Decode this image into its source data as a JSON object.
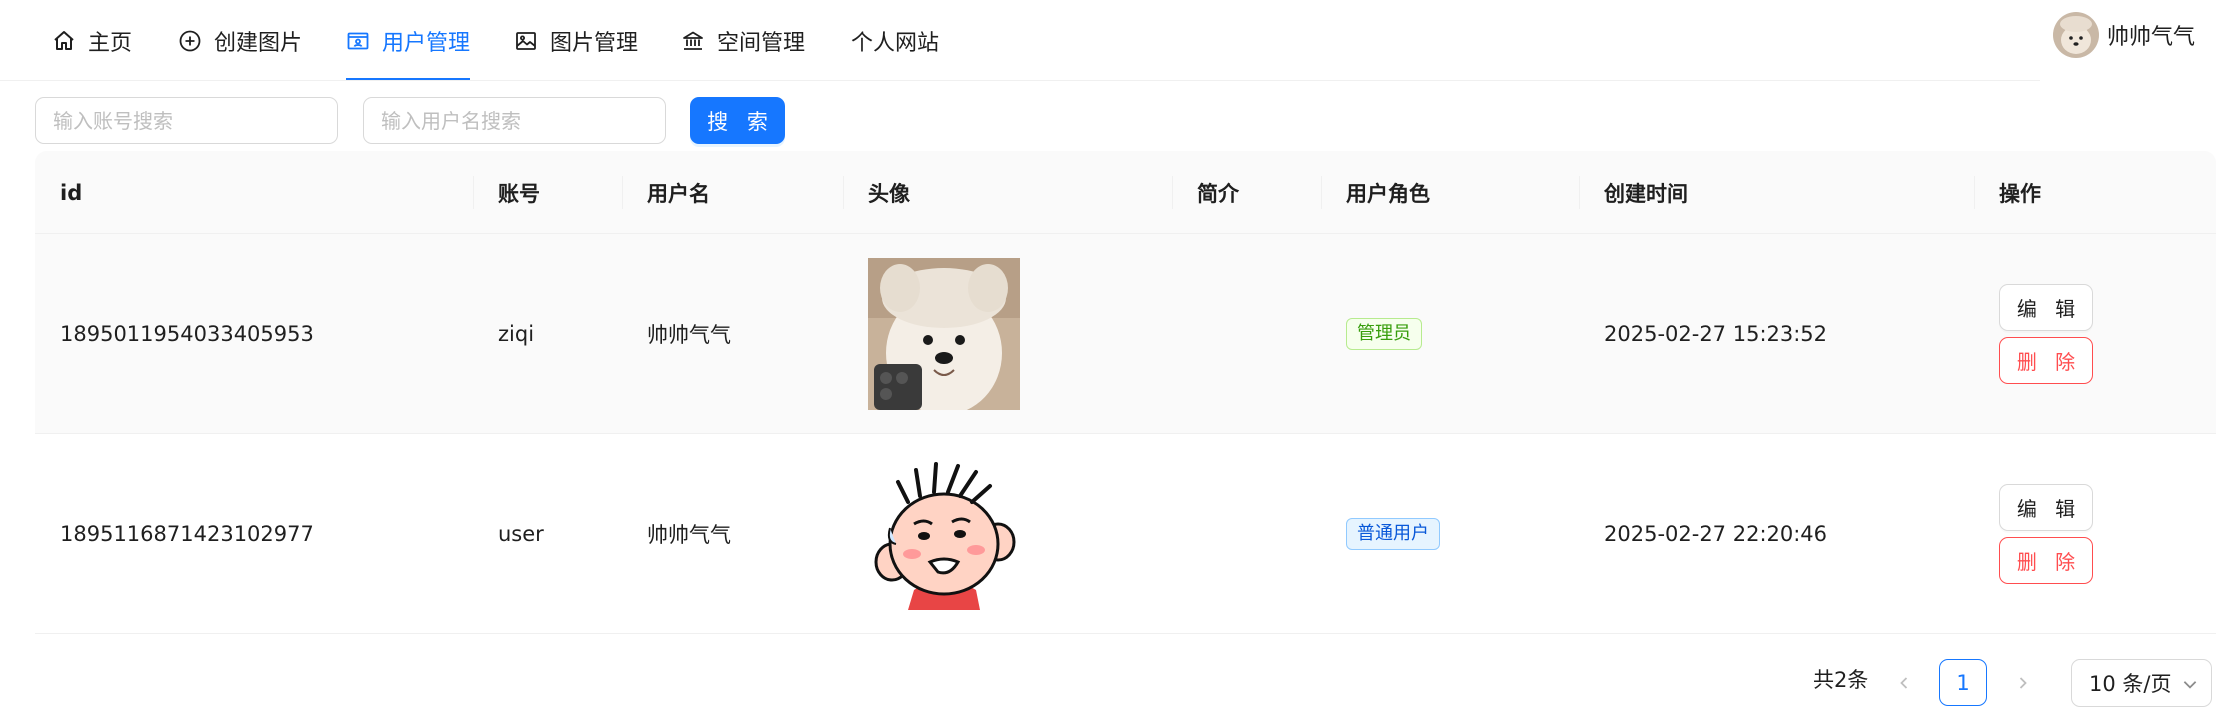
{
  "nav": {
    "items": [
      {
        "label": "主页",
        "icon": "home-icon"
      },
      {
        "label": "创建图片",
        "icon": "plus-circle-icon"
      },
      {
        "label": "用户管理",
        "icon": "idcard-icon",
        "active": true
      },
      {
        "label": "图片管理",
        "icon": "picture-icon"
      },
      {
        "label": "空间管理",
        "icon": "bank-icon"
      },
      {
        "label": "个人网站",
        "icon": ""
      }
    ],
    "user_name": "帅帅气气"
  },
  "search": {
    "account_placeholder": "输入账号搜索",
    "account_value": "",
    "username_placeholder": "输入用户名搜索",
    "username_value": "",
    "button_label": "搜 索"
  },
  "table": {
    "columns": [
      "id",
      "账号",
      "用户名",
      "头像",
      "简介",
      "用户角色",
      "创建时间",
      "操作"
    ],
    "rows": [
      {
        "id": "1895011954033405953",
        "account": "ziqi",
        "username": "帅帅气气",
        "avatar": "dog-photo-avatar",
        "profile": "",
        "role": "管理员",
        "role_color": "green",
        "created": "2025-02-27 15:23:52",
        "edit_label": "编 辑",
        "delete_label": "删 除"
      },
      {
        "id": "1895116871423102977",
        "account": "user",
        "username": "帅帅气气",
        "avatar": "cartoon-boy-avatar",
        "profile": "",
        "role": "普通用户",
        "role_color": "blue",
        "created": "2025-02-27 22:20:46",
        "edit_label": "编 辑",
        "delete_label": "删 除"
      }
    ]
  },
  "pagination": {
    "total_label": "共2条",
    "current_page": "1",
    "page_size_label": "10 条/页"
  },
  "colors": {
    "primary": "#1677ff",
    "danger": "#ff4d4f",
    "admin_tag": "#389e0d",
    "user_tag": "#0958d9"
  }
}
